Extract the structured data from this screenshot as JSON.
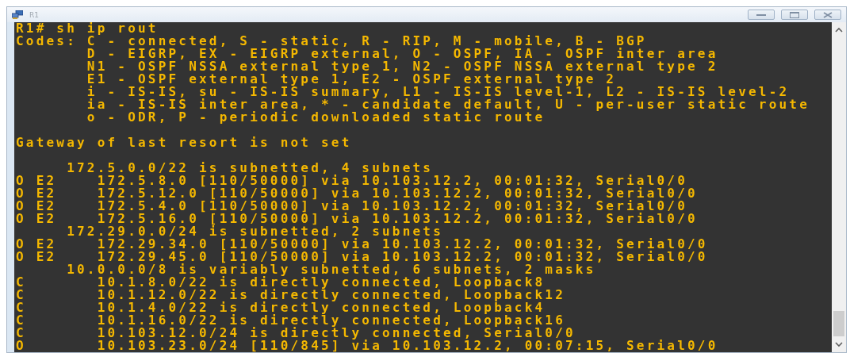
{
  "window": {
    "title": "R1"
  },
  "terminal": {
    "lines": [
      {
        "kind": "text",
        "text": "R1# sh ip rout"
      },
      {
        "kind": "text",
        "text": "Codes: C - connected, S - static, R - RIP, M - mobile, B - BGP"
      },
      {
        "kind": "text",
        "text": "       D - EIGRP, EX - EIGRP external, O - OSPF, IA - OSPF inter area"
      },
      {
        "kind": "text",
        "text": "       N1 - OSPF NSSA external type 1, N2 - OSPF NSSA external type 2"
      },
      {
        "kind": "text",
        "text": "       E1 - OSPF external type 1, E2 - OSPF external type 2"
      },
      {
        "kind": "text",
        "text": "       i - IS-IS, su - IS-IS summary, L1 - IS-IS level-1, L2 - IS-IS level-2"
      },
      {
        "kind": "text",
        "text": "       ia - IS-IS inter area, * - candidate default, U - per-user static route"
      },
      {
        "kind": "text",
        "text": "       o - ODR, P - periodic downloaded static route"
      },
      {
        "kind": "blank"
      },
      {
        "kind": "text",
        "text": "Gateway of last resort is not set"
      },
      {
        "kind": "blank"
      },
      {
        "kind": "text",
        "text": "     172.5.0.0/22 is subnetted, 4 subnets"
      },
      {
        "kind": "text",
        "text": "O E2    172.5.8.0 [110/50000] via 10.103.12.2, 00:01:32, Serial0/0"
      },
      {
        "kind": "text",
        "text": "O E2    172.5.12.0 [110/50000] via 10.103.12.2, 00:01:32, Serial0/0"
      },
      {
        "kind": "text",
        "text": "O E2    172.5.4.0 [110/50000] via 10.103.12.2, 00:01:32, Serial0/0"
      },
      {
        "kind": "text",
        "text": "O E2    172.5.16.0 [110/50000] via 10.103.12.2, 00:01:32, Serial0/0"
      },
      {
        "kind": "text",
        "text": "     172.29.0.0/24 is subnetted, 2 subnets"
      },
      {
        "kind": "text",
        "text": "O E2    172.29.34.0 [110/50000] via 10.103.12.2, 00:01:32, Serial0/0"
      },
      {
        "kind": "text",
        "text": "O E2    172.29.45.0 [110/50000] via 10.103.12.2, 00:01:32, Serial0/0"
      },
      {
        "kind": "text",
        "text": "     10.0.0.0/8 is variably subnetted, 6 subnets, 2 masks"
      },
      {
        "kind": "text",
        "text": "C       10.1.8.0/22 is directly connected, Loopback8"
      },
      {
        "kind": "text",
        "text": "C       10.1.12.0/22 is directly connected, Loopback12"
      },
      {
        "kind": "text",
        "text": "C       10.1.4.0/22 is directly connected, Loopback4"
      },
      {
        "kind": "text",
        "text": "C       10.1.16.0/22 is directly connected, Loopback16"
      },
      {
        "kind": "text",
        "text": "C       10.103.12.0/24 is directly connected, Serial0/0"
      },
      {
        "kind": "text",
        "text": "O       10.103.23.0/24 [110/845] via 10.103.12.2, 00:07:15, Serial0/0"
      }
    ]
  }
}
